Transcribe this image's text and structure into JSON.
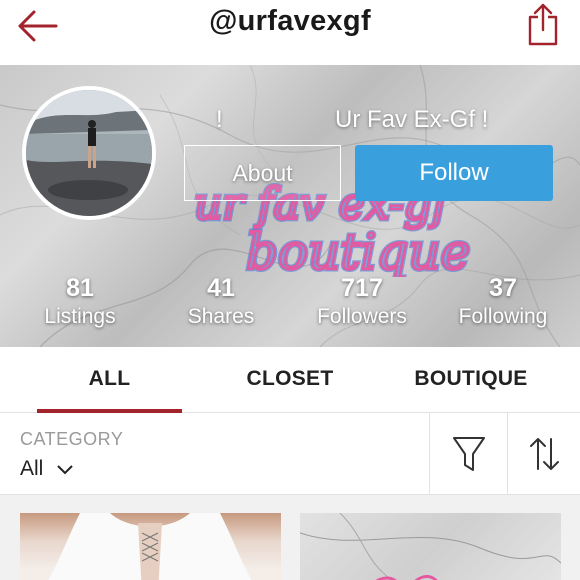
{
  "header": {
    "back_icon": "back-arrow-icon",
    "username": "@urfavexgf",
    "share_icon": "share-icon"
  },
  "profile": {
    "avatar": "avatar-photo",
    "name_prefix": "!",
    "display_name": "Ur Fav Ex-Gf !",
    "about_label": "About",
    "follow_label": "Follow",
    "brand_art_lines": [
      "ur fav ex-gf",
      "boutique"
    ]
  },
  "stats": [
    {
      "value": "81",
      "label": "Listings"
    },
    {
      "value": "41",
      "label": "Shares"
    },
    {
      "value": "717",
      "label": "Followers"
    },
    {
      "value": "37",
      "label": "Following"
    }
  ],
  "tabs": [
    {
      "label": "ALL",
      "active": true
    },
    {
      "label": "CLOSET",
      "active": false
    },
    {
      "label": "BOUTIQUE",
      "active": false
    }
  ],
  "filter": {
    "category_label": "CATEGORY",
    "category_value": "All",
    "filter_icon": "filter-funnel-icon",
    "sort_icon": "sort-arrows-icon"
  },
  "listings": [
    {
      "name": "listing-thumbnail-1"
    },
    {
      "name": "listing-thumbnail-2"
    }
  ],
  "colors": {
    "accent": "#a3232d",
    "follow": "#3aa0dd",
    "brand_art_pink": "#e35aa0",
    "brand_art_blue": "#4a78d8"
  }
}
